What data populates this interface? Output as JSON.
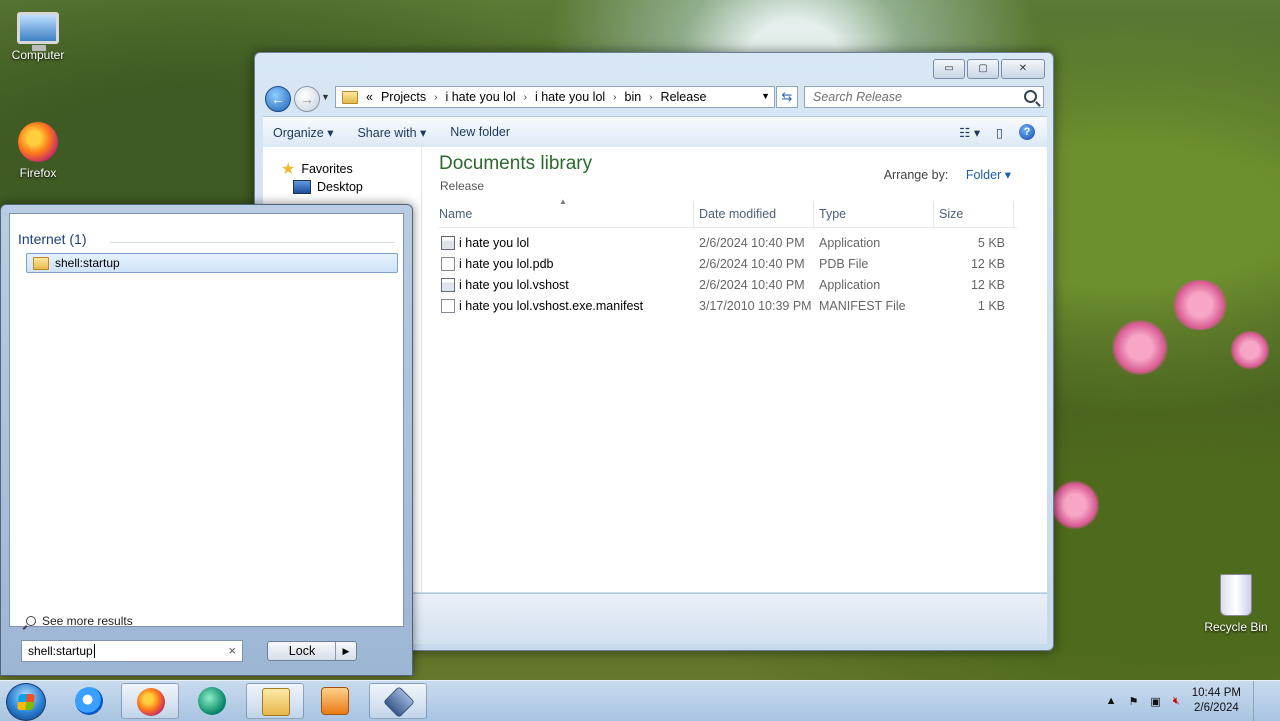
{
  "desktop": {
    "icons": [
      {
        "label": "Computer",
        "icon": "computer-icon"
      },
      {
        "label": "Firefox",
        "icon": "firefox-icon"
      },
      {
        "label": "Recycle Bin",
        "icon": "recycle-bin-icon"
      }
    ]
  },
  "explorer": {
    "window_buttons": {
      "minimize": "▭",
      "maximize": "▢",
      "close": "✕"
    },
    "breadcrumb": [
      "«",
      "Projects",
      "i hate you lol",
      "i hate you lol",
      "bin",
      "Release"
    ],
    "search_placeholder": "Search Release",
    "toolbar": {
      "organize": "Organize ▾",
      "share_with": "Share with ▾",
      "new_folder": "New folder",
      "view_toggle": "▾"
    },
    "nav": {
      "favorites": "Favorites",
      "desktop": "Desktop"
    },
    "library_title": "Documents library",
    "library_subtitle": "Release",
    "arrange_label": "Arrange by:",
    "arrange_value": "Folder ▾",
    "columns": {
      "name": "Name",
      "date": "Date modified",
      "type": "Type",
      "size": "Size"
    },
    "files": [
      {
        "name": "i hate you lol",
        "date": "2/6/2024 10:40 PM",
        "type": "Application",
        "size": "5 KB",
        "icon": "application-icon"
      },
      {
        "name": "i hate you lol.pdb",
        "date": "2/6/2024 10:40 PM",
        "type": "PDB File",
        "size": "12 KB",
        "icon": "file-icon"
      },
      {
        "name": "i hate you lol.vshost",
        "date": "2/6/2024 10:40 PM",
        "type": "Application",
        "size": "12 KB",
        "icon": "application-icon"
      },
      {
        "name": "i hate you lol.vshost.exe.manifest",
        "date": "3/17/2010 10:39 PM",
        "type": "MANIFEST File",
        "size": "1 KB",
        "icon": "file-icon"
      }
    ]
  },
  "start_menu": {
    "group_label": "Internet (1)",
    "result": "shell:startup",
    "see_more": "See more results",
    "search_value": "shell:startup",
    "clear": "×",
    "lock_label": "Lock",
    "lock_arrow": "▶"
  },
  "taskbar": {
    "apps": [
      "internet-explorer-icon",
      "firefox-icon",
      "green-app-icon",
      "file-explorer-icon",
      "media-player-icon",
      "virtualbox-icon"
    ],
    "clock_time": "10:44 PM",
    "clock_date": "2/6/2024",
    "tray_arrow": "▲"
  }
}
